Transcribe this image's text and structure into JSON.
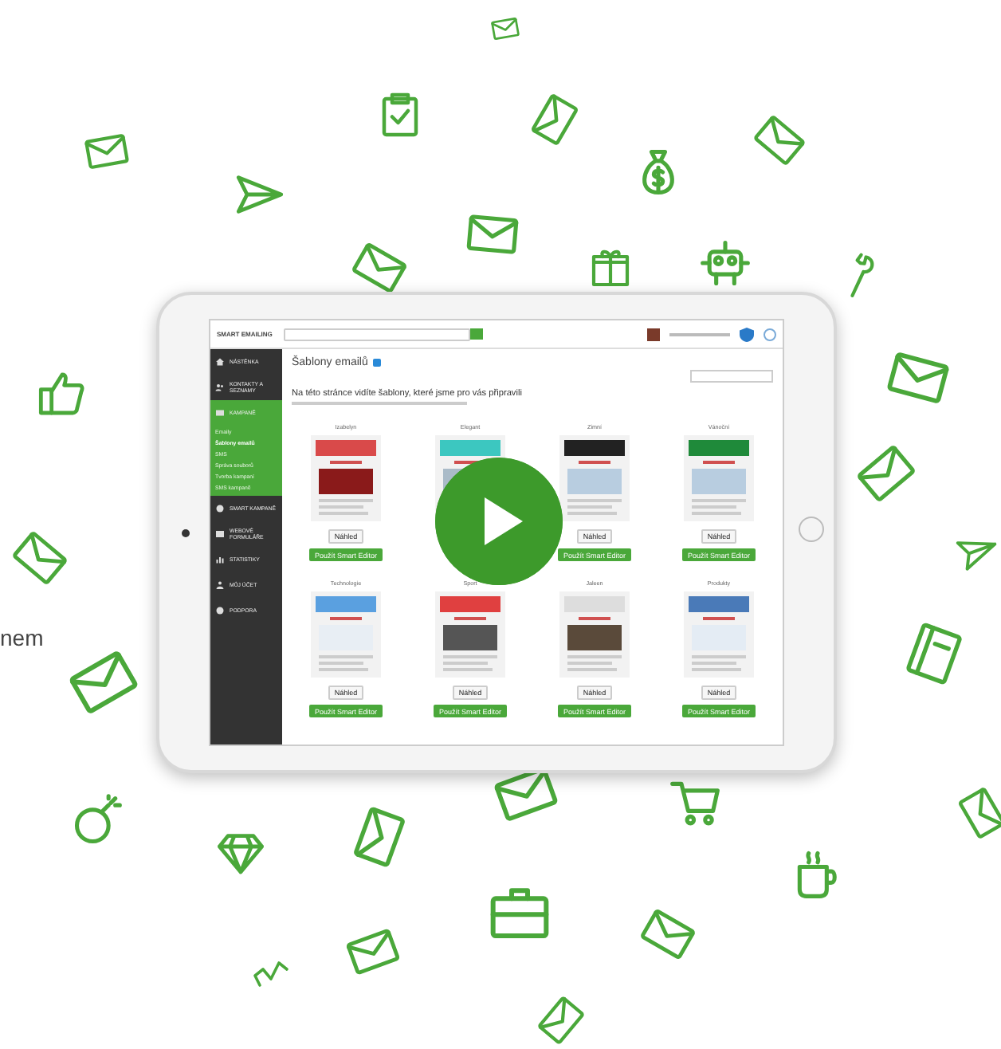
{
  "page_text": "nem",
  "app": {
    "logo": "SMART EMAILING",
    "sidebar": [
      {
        "label": "NÁSTĚNKA",
        "selected": false
      },
      {
        "label": "KONTAKTY A SEZNAMY",
        "selected": false
      },
      {
        "label": "KAMPANĚ",
        "selected": true,
        "children": [
          {
            "label": "Emaily",
            "selected": false
          },
          {
            "label": "Šablony emailů",
            "selected": true
          },
          {
            "label": "SMS",
            "selected": false
          },
          {
            "label": "Správa souborů",
            "selected": false
          },
          {
            "label": "Tvorba kampaní",
            "selected": false
          },
          {
            "label": "SMS kampaně",
            "selected": false
          }
        ]
      },
      {
        "label": "SMART KAMPANĚ",
        "selected": false
      },
      {
        "label": "WEBOVÉ FORMULÁŘE",
        "selected": false
      },
      {
        "label": "STATISTIKY",
        "selected": false
      },
      {
        "label": "MŮJ ÚČET",
        "selected": false
      },
      {
        "label": "PODPORA",
        "selected": false
      }
    ],
    "page_title": "Šablony emailů",
    "heading": "Na této stránce vidíte šablony, které jsme pro vás připravili",
    "templates": [
      {
        "title": "Izabelyn",
        "preview": "Náhled",
        "use": "Použít Smart Editor"
      },
      {
        "title": "Elegant"
      },
      {
        "title": "Zimní",
        "preview": "Náhled",
        "use": "Použít Smart Editor"
      },
      {
        "title": "Vánoční",
        "preview": "Náhled",
        "use": "Použít Smart Editor"
      },
      {
        "title": "Technologie",
        "preview": "Náhled",
        "use": "Použít Smart Editor"
      },
      {
        "title": "Sport",
        "preview": "Náhled",
        "use": "Použít Smart Editor"
      },
      {
        "title": "Jaleen",
        "preview": "Náhled",
        "use": "Použít Smart Editor"
      },
      {
        "title": "Produkty",
        "preview": "Náhled",
        "use": "Použít Smart Editor"
      }
    ]
  }
}
